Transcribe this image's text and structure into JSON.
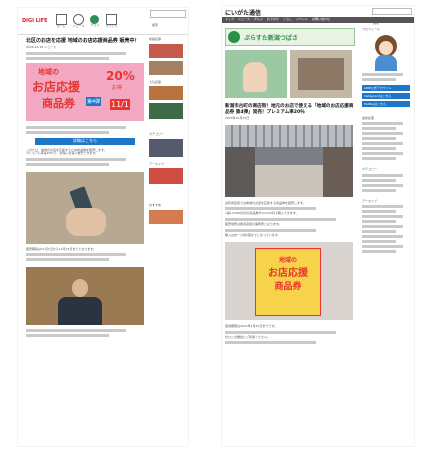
{
  "pageA": {
    "header": {
      "logo_text": "DIGI LIFE",
      "nav": [
        "ホーム",
        "ニュース",
        "グルメ",
        "イベント"
      ],
      "search_placeholder": "検索"
    },
    "article": {
      "title": "北区のお店を応援 地域のお店応援商品券 販売中！",
      "meta": "2020.10.15 ニュース",
      "banner": {
        "line1": "地域の",
        "line2": "お店応援",
        "line3": "商品券",
        "badge": "第4弾",
        "percent": "20%",
        "percent_suffix": "お得",
        "date": "11/1"
      },
      "cta_label": "詳細はこちら",
      "paragraphs": [
        "このたび、地域のお店を応援するため商品券を販売します。",
        "プレミアム率は20%で、お得にお買い物ができます。",
        "販売期間は11月1日から11月15日までとなります。"
      ]
    },
    "sidebar": {
      "labels": [
        "新着記事",
        "人気記事",
        "カテゴリー",
        "アーカイブ",
        "おすすめ"
      ]
    }
  },
  "pageB": {
    "header": {
      "site_title": "にいがた通信",
      "search_placeholder": "検索",
      "nav": [
        "トップ",
        "ニュース",
        "グルメ",
        "おでかけ",
        "くらし",
        "イベント",
        "お問い合わせ"
      ]
    },
    "ad": {
      "text": "ぷらすた新潟つばさ"
    },
    "article": {
      "title": "新潟市古町の商店街！地元のお店で使える「地域のお店応援商品券 第4弾」発売！プレミアム率20％",
      "meta": "2020年10月15日",
      "poster": {
        "line1": "地域の",
        "line2": "お店応援",
        "line3": "商品券"
      },
      "paragraphs": [
        "古町商店街では地域のお店を応援する商品券を販売します。",
        "1冊12,000円分の商品券が10,000円で購入できます。",
        "販売場所は各商店街の事務所となります。",
        "購入はお一人様5冊までとなっています。",
        "使用期限は2021年1月31日までです。",
        "ぜひこの機会にご利用ください。"
      ]
    },
    "sidebar": {
      "profile_caption": "プロフィール",
      "buttons": [
        "LINE公式アカウント",
        "Instagramはこちら",
        "Twitterはこちら"
      ],
      "section_titles": [
        "最新記事",
        "カテゴリー",
        "アーカイブ"
      ]
    }
  },
  "colors": {
    "accent_red": "#e8352f",
    "accent_blue": "#1d77c9",
    "banner_pink": "#f3a8c2",
    "yellow": "#f6d34a",
    "ad_green": "#2a8f4a",
    "header_gray": "#dddddd"
  }
}
